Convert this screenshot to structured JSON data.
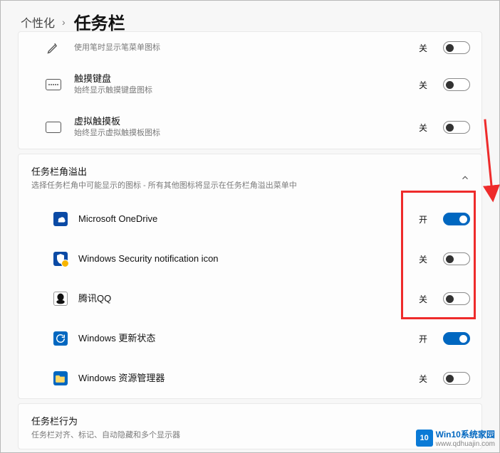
{
  "breadcrumb": {
    "parent": "个性化",
    "current": "任务栏"
  },
  "cornerIcons": {
    "pen": {
      "title": "",
      "sub": "使用笔时显示笔菜单图标",
      "state": "关"
    },
    "touchKbd": {
      "title": "触摸键盘",
      "sub": "始终显示触摸键盘图标",
      "state": "关"
    },
    "touchpad": {
      "title": "虚拟触摸板",
      "sub": "始终显示虚拟触摸板图标",
      "state": "关"
    }
  },
  "overflow": {
    "title": "任务栏角溢出",
    "sub": "选择任务栏角中可能显示的图标 - 所有其他图标将显示在任务栏角溢出菜单中",
    "items": [
      {
        "title": "Microsoft OneDrive",
        "state": "开",
        "icon": "onedrive"
      },
      {
        "title": "Windows Security notification icon",
        "state": "关",
        "icon": "security"
      },
      {
        "title": "腾讯QQ",
        "state": "关",
        "icon": "qq"
      },
      {
        "title": "Windows 更新状态",
        "state": "开",
        "icon": "update"
      },
      {
        "title": "Windows 资源管理器",
        "state": "关",
        "icon": "explorer"
      }
    ]
  },
  "behaviors": {
    "title": "任务栏行为",
    "sub": "任务栏对齐、标记、自动隐藏和多个显示器"
  },
  "stateOn": "开",
  "stateOff": "关",
  "watermark": {
    "brand": "Win10系统家园",
    "url": "www.qdhuajin.com",
    "logo": "10"
  }
}
